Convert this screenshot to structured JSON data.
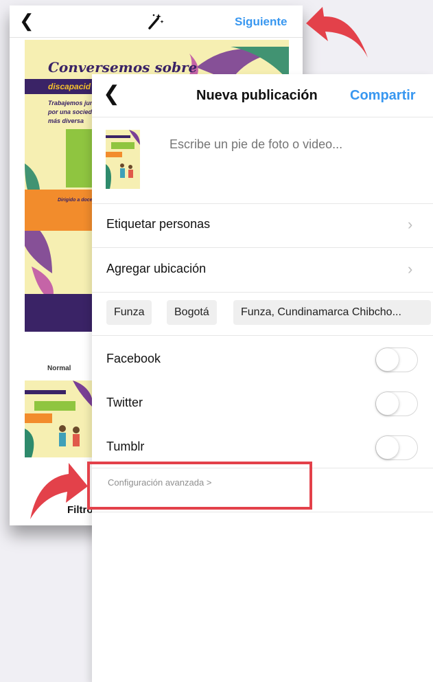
{
  "back_screen": {
    "next_label": "Siguiente",
    "poster_title_1": "Conversemos sobre",
    "poster_title_2": "discapacid",
    "poster_text": "Trabajemos juntos por una sociedad más diversa",
    "poster_orange_text": "Dirigido a docentes y padres",
    "filter_label": "Normal",
    "filter_tab_label": "Filtro"
  },
  "new_post": {
    "title": "Nueva publicación",
    "share_label": "Compartir",
    "caption_placeholder": "Escribe un pie de foto o video...",
    "tag_people_label": "Etiquetar personas",
    "add_location_label": "Agregar ubicación",
    "location_chips": [
      "Funza",
      "Bogotá",
      "Funza, Cundinamarca Chibcho..."
    ],
    "share_targets": [
      {
        "label": "Facebook",
        "enabled": false
      },
      {
        "label": "Twitter",
        "enabled": false
      },
      {
        "label": "Tumblr",
        "enabled": false
      }
    ],
    "advanced_settings_label": "Configuración avanzada >"
  },
  "colors": {
    "accent_blue": "#3897f0",
    "annotation_red": "#e3414a",
    "poster_purple": "#3a2366",
    "poster_yellow": "#f6efb2"
  }
}
